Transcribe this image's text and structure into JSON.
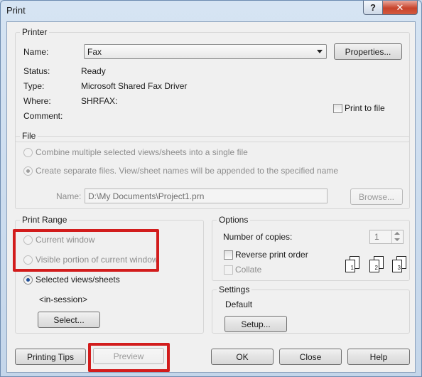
{
  "window": {
    "title": "Print",
    "help": "?",
    "close": "✕"
  },
  "printer": {
    "group_label": "Printer",
    "name_label": "Name:",
    "name_value": "Fax",
    "properties_label": "Properties...",
    "status_label": "Status:",
    "status_value": "Ready",
    "type_label": "Type:",
    "type_value": "Microsoft Shared Fax Driver",
    "where_label": "Where:",
    "where_value": "SHRFAX:",
    "comment_label": "Comment:",
    "print_to_file_label": "Print to file"
  },
  "file": {
    "group_label": "File",
    "combine_label": "Combine multiple selected views/sheets into a single file",
    "separate_label": "Create separate files. View/sheet names will be appended to the specified name",
    "name_label": "Name:",
    "name_value": "D:\\My Documents\\Project1.prn",
    "browse_label": "Browse..."
  },
  "print_range": {
    "group_label": "Print Range",
    "current_window_label": "Current window",
    "visible_portion_label": "Visible portion of current window",
    "selected_views_label": "Selected views/sheets",
    "session_label": "<in-session>",
    "select_label": "Select..."
  },
  "options": {
    "group_label": "Options",
    "copies_label": "Number of copies:",
    "copies_value": "1",
    "reverse_label": "Reverse print order",
    "collate_label": "Collate",
    "collate_pages": [
      "1",
      "2",
      "3"
    ]
  },
  "settings": {
    "group_label": "Settings",
    "value": "Default",
    "setup_label": "Setup..."
  },
  "footer": {
    "printing_tips_label": "Printing Tips",
    "preview_label": "Preview",
    "ok_label": "OK",
    "close_label": "Close",
    "help_label": "Help"
  },
  "colors": {
    "highlight": "#d21c1c",
    "radio_dot": "#1f4f99"
  }
}
